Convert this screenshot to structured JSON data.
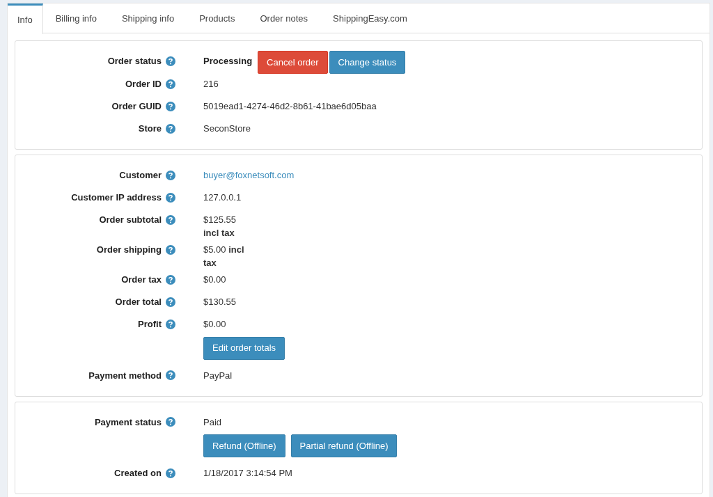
{
  "tabs": [
    {
      "label": "Info",
      "selected": true
    },
    {
      "label": "Billing info",
      "selected": false
    },
    {
      "label": "Shipping info",
      "selected": false
    },
    {
      "label": "Products",
      "selected": false
    },
    {
      "label": "Order notes",
      "selected": false
    },
    {
      "label": "ShippingEasy.com",
      "selected": false
    }
  ],
  "sections": [
    {
      "rows": [
        {
          "label": "Order status",
          "kind": "status",
          "value": "Processing",
          "buttons": [
            {
              "label": "Cancel order",
              "kind": "danger"
            },
            {
              "label": "Change status",
              "kind": "primary"
            }
          ]
        },
        {
          "label": "Order ID",
          "kind": "text",
          "value": "216"
        },
        {
          "label": "Order GUID",
          "kind": "text",
          "value": "5019ead1-4274-46d2-8b61-41bae6d05baa"
        },
        {
          "label": "Store",
          "kind": "text",
          "value": "SeconStore"
        }
      ]
    },
    {
      "rows": [
        {
          "label": "Customer",
          "kind": "link",
          "value": "buyer@foxnetsoft.com"
        },
        {
          "label": "Customer IP address",
          "kind": "text",
          "value": "127.0.0.1"
        },
        {
          "label": "Order subtotal",
          "kind": "price",
          "value": "$125.55 **incl tax**"
        },
        {
          "label": "Order shipping",
          "kind": "price",
          "value": "$5.00 **incl tax**"
        },
        {
          "label": "Order tax",
          "kind": "text",
          "value": "$0.00"
        },
        {
          "label": "Order total",
          "kind": "text",
          "value": "$130.55"
        },
        {
          "label": "Profit",
          "kind": "text",
          "value": "$0.00",
          "buttons_below": [
            {
              "label": "Edit order totals",
              "kind": "primary"
            }
          ]
        },
        {
          "label": "Payment method",
          "kind": "text",
          "value": "PayPal"
        }
      ]
    },
    {
      "rows": [
        {
          "label": "Payment status",
          "kind": "text",
          "value": "Paid",
          "buttons_below": [
            {
              "label": "Refund (Offline)",
              "kind": "primary"
            },
            {
              "label": "Partial refund (Offline)",
              "kind": "primary"
            }
          ]
        },
        {
          "label": "Created on",
          "kind": "text",
          "value": "1/18/2017 3:14:54 PM"
        }
      ]
    }
  ]
}
